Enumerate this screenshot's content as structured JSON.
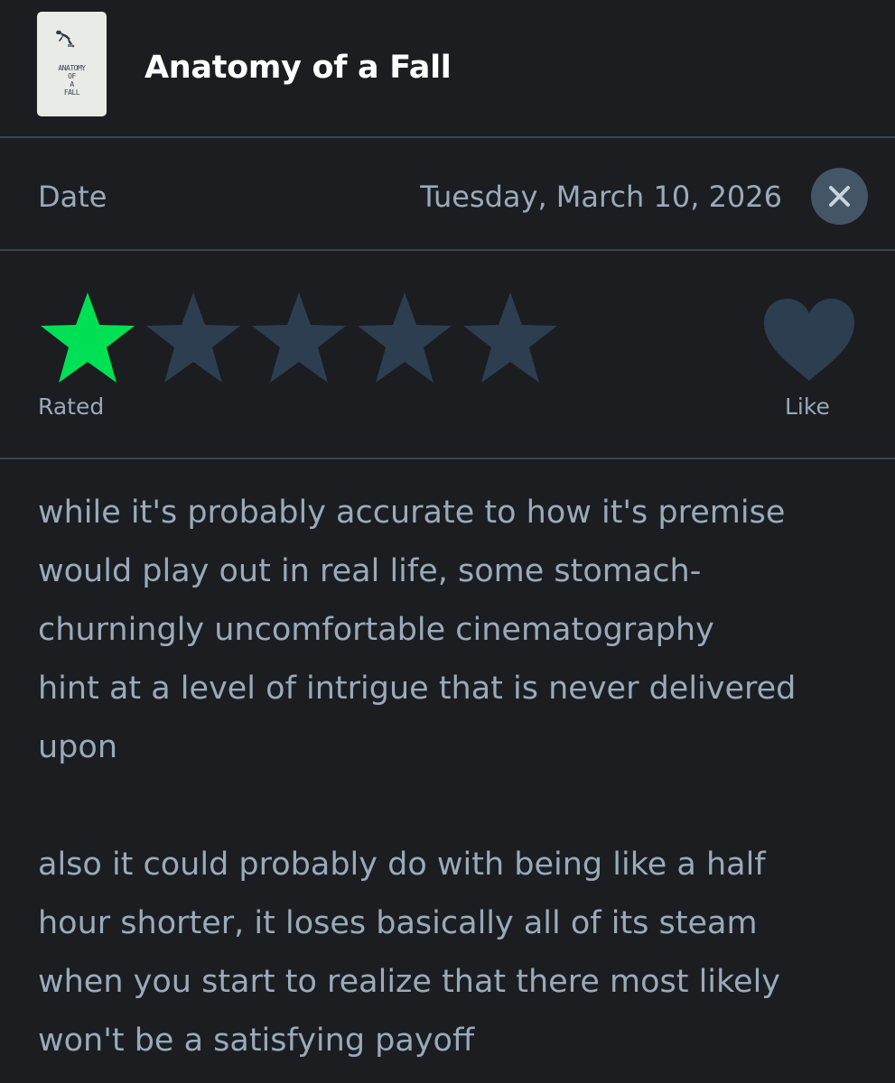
{
  "film": {
    "title": "Anatomy of a Fall",
    "poster_text": "ANATOMY\nOF\nA\nFALL"
  },
  "date_row": {
    "label": "Date",
    "value": "Tuesday, March 10, 2026",
    "close_icon": "close-icon"
  },
  "rating": {
    "stars_filled": 1,
    "stars_total": 5,
    "label": "Rated",
    "filled_color": "#00e054",
    "empty_color": "#2c3e50"
  },
  "like": {
    "label": "Like",
    "liked": false,
    "icon": "heart-icon",
    "color": "#2c3e50"
  },
  "review": {
    "paragraphs": [
      "while it's probably accurate to how it's premise\nwould play out in real life, some stomach-\nchurningly uncomfortable cinematography\nhint at a level of intrigue that is never delivered\nupon",
      "also it could probably do with being like a half\nhour shorter, it loses basically all of its steam\nwhen you start to realize that there most likely\nwon't be a satisfying payoff"
    ]
  },
  "colors": {
    "background": "#1b1d21",
    "divider": "#3a4553",
    "text_muted": "#99aabb",
    "close_button_bg": "#445566"
  }
}
